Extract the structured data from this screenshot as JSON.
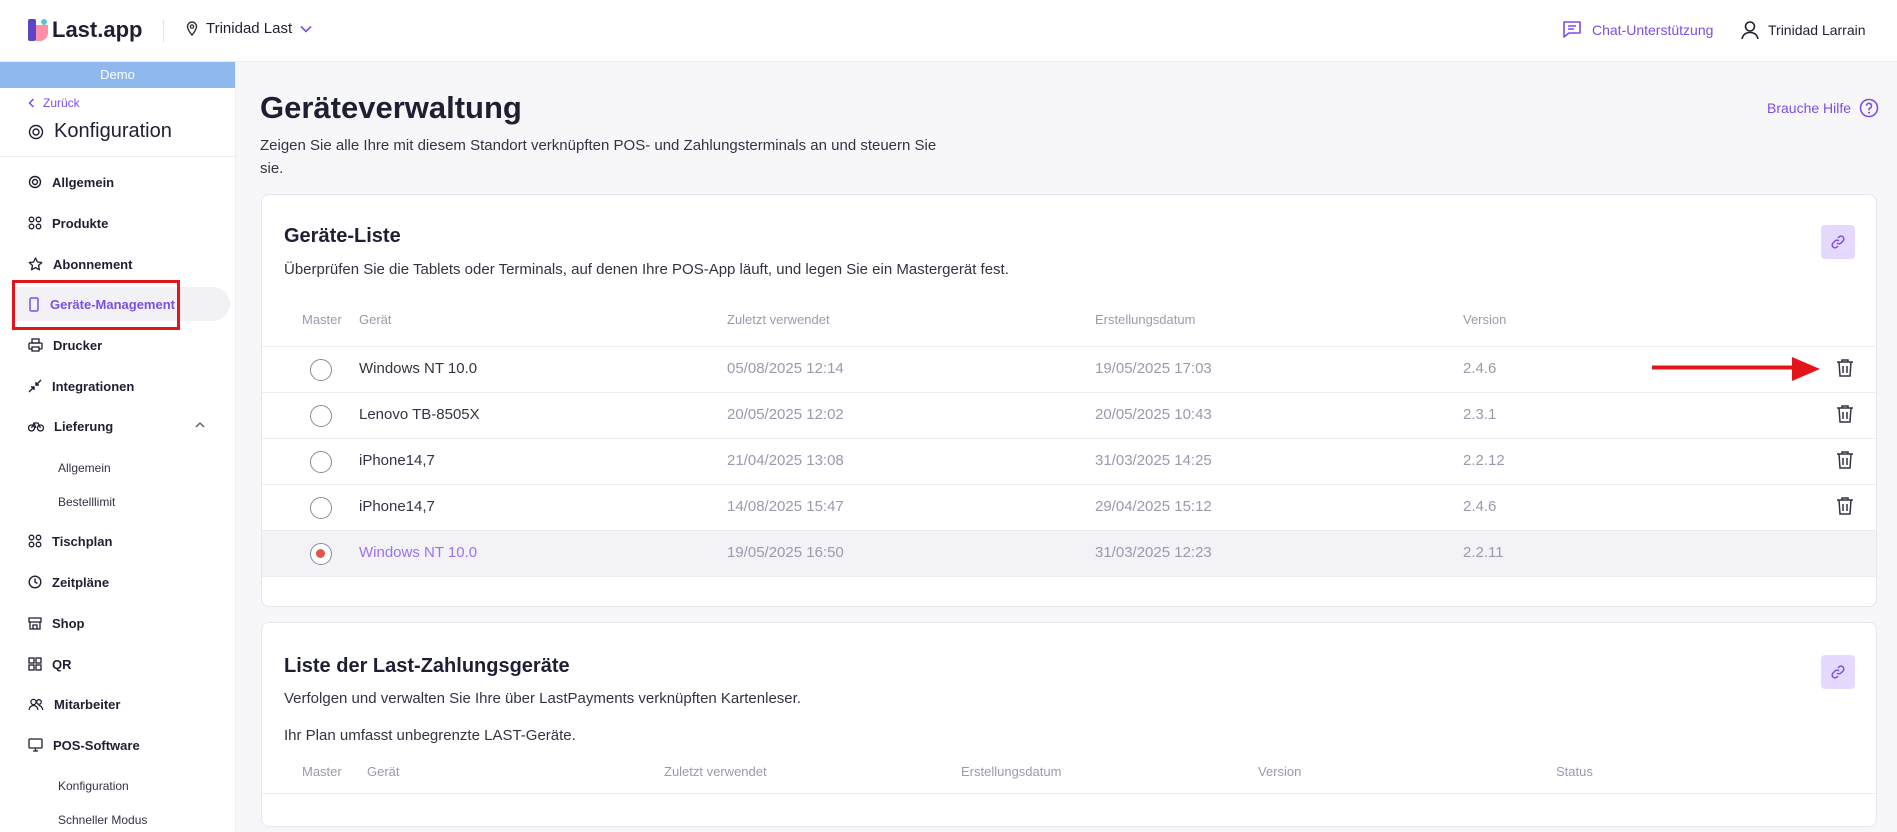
{
  "header": {
    "logo_text": "Last.app",
    "location": "Trinidad Last",
    "chat_label": "Chat-Unterstützung",
    "user_name": "Trinidad Larrain"
  },
  "sidebar": {
    "demo_label": "Demo",
    "back_label": "Zurück",
    "section_title": "Konfiguration",
    "items": [
      {
        "label": "Allgemein",
        "icon": "gear-icon"
      },
      {
        "label": "Produkte",
        "icon": "grid-icon"
      },
      {
        "label": "Abonnement",
        "icon": "star-icon"
      },
      {
        "label": "Geräte-Management",
        "icon": "phone-icon",
        "active": true
      },
      {
        "label": "Drucker",
        "icon": "printer-icon"
      },
      {
        "label": "Integrationen",
        "icon": "arrows-icon"
      },
      {
        "label": "Lieferung",
        "icon": "bike-icon",
        "expanded": true
      },
      {
        "label": "Allgemein"
      },
      {
        "label": "Bestelllimit"
      },
      {
        "label": "Tischplan",
        "icon": "grid-icon"
      },
      {
        "label": "Zeitpläne",
        "icon": "clock-icon"
      },
      {
        "label": "Shop",
        "icon": "store-icon"
      },
      {
        "label": "QR",
        "icon": "qr-icon"
      },
      {
        "label": "Mitarbeiter",
        "icon": "people-icon"
      },
      {
        "label": "POS-Software",
        "icon": "monitor-icon"
      },
      {
        "label": "Konfiguration"
      },
      {
        "label": "Schneller Modus"
      }
    ]
  },
  "main": {
    "title": "Geräteverwaltung",
    "description": "Zeigen Sie alle Ihre mit diesem Standort verknüpften POS- und Zahlungsterminals an und steuern Sie sie.",
    "help_label": "Brauche Hilfe"
  },
  "devices_card": {
    "title": "Geräte-Liste",
    "description": "Überprüfen Sie die Tablets oder Terminals, auf denen Ihre POS-App läuft, und legen Sie ein Mastergerät fest.",
    "columns": [
      "Master",
      "Gerät",
      "Zuletzt verwendet",
      "Erstellungsdatum",
      "Version"
    ],
    "rows": [
      {
        "device": "Windows NT 10.0",
        "last_used": "05/08/2025 12:14",
        "created": "19/05/2025 17:03",
        "version": "2.4.6",
        "master": false
      },
      {
        "device": "Lenovo TB-8505X",
        "last_used": "20/05/2025 12:02",
        "created": "20/05/2025 10:43",
        "version": "2.3.1",
        "master": false
      },
      {
        "device": "iPhone14,7",
        "last_used": "21/04/2025 13:08",
        "created": "31/03/2025 14:25",
        "version": "2.2.12",
        "master": false
      },
      {
        "device": "iPhone14,7",
        "last_used": "14/08/2025 15:47",
        "created": "29/04/2025 15:12",
        "version": "2.4.6",
        "master": false
      },
      {
        "device": "Windows NT 10.0",
        "last_used": "19/05/2025 16:50",
        "created": "31/03/2025 12:23",
        "version": "2.2.11",
        "master": true
      }
    ]
  },
  "payments_card": {
    "title": "Liste der Last-Zahlungsgeräte",
    "description": "Verfolgen und verwalten Sie Ihre über LastPayments verknüpften Kartenleser.",
    "plan_note": "Ihr Plan umfasst unbegrenzte LAST-Geräte.",
    "columns": [
      "Master",
      "Gerät",
      "Zuletzt verwendet",
      "Erstellungsdatum",
      "Version",
      "Status"
    ]
  },
  "colors": {
    "accent": "#7c4dea",
    "highlight_red": "#e3141b",
    "demo_bar": "#8fb8ee"
  }
}
